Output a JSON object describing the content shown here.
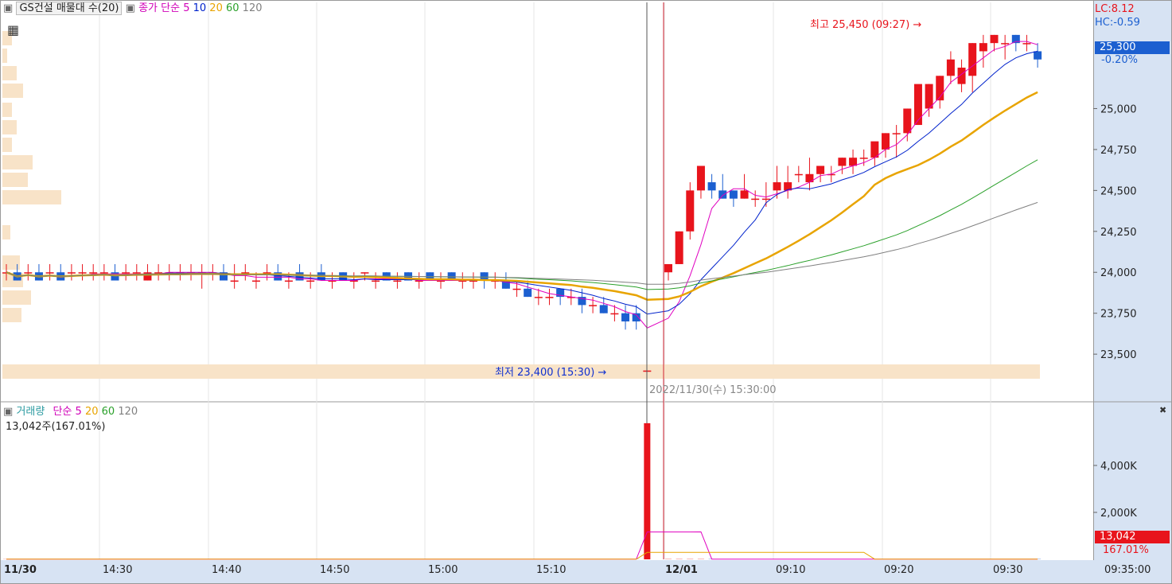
{
  "price_panel": {
    "title": "GS건설 매물대 수(20)",
    "ma_label": "종가 단순",
    "ma_periods": [
      "5",
      "10",
      "20",
      "60",
      "120"
    ],
    "ma_colors": [
      "#e000c0",
      "#0022cc",
      "#e8a400",
      "#2aa02a",
      "#808080"
    ],
    "lc": "LC:8.12",
    "hc": "HC:-0.59",
    "current_price": "25,300",
    "current_change": "-0.20%",
    "high_annotation": "최고 25,450 (09:27)",
    "low_annotation": "최저 23,400 (15:30)",
    "crosshair_label": "2022/11/30(수) 15:30:00"
  },
  "volume_panel": {
    "title": "거래량",
    "ma_label": "단순",
    "ma_periods": [
      "5",
      "20",
      "60",
      "120"
    ],
    "ma_colors": [
      "#e000c0",
      "#e8a400",
      "#2aa02a",
      "#808080"
    ],
    "summary": "13,042주(167.01%)",
    "current_volume": "13,042",
    "current_ratio": "167.01%"
  },
  "time_axis": {
    "labels": [
      "11/30",
      "14:30",
      "14:40",
      "14:50",
      "15:00",
      "15:10",
      "12/01",
      "09:10",
      "09:20",
      "09:30"
    ],
    "cursor_time": "09:35:00"
  },
  "colors": {
    "up": "#e8141c",
    "down": "#1c5fd0",
    "axis_bg": "#d7e3f3",
    "volume_profile": "#f8e3c8",
    "crosshair": "#d02030"
  },
  "chart_data": [
    {
      "type": "candlestick",
      "title": "GS건설 매물대 수(20)",
      "x": [
        "14:21",
        "14:22",
        "14:23",
        "14:24",
        "14:25",
        "14:26",
        "14:27",
        "14:28",
        "14:29",
        "14:30",
        "14:31",
        "14:32",
        "14:33",
        "14:34",
        "14:35",
        "14:36",
        "14:37",
        "14:38",
        "14:39",
        "14:40",
        "14:41",
        "14:42",
        "14:43",
        "14:44",
        "14:45",
        "14:46",
        "14:47",
        "14:48",
        "14:49",
        "14:50",
        "14:51",
        "14:52",
        "14:53",
        "14:54",
        "14:55",
        "14:56",
        "14:57",
        "14:58",
        "14:59",
        "15:00",
        "15:01",
        "15:02",
        "15:03",
        "15:04",
        "15:05",
        "15:06",
        "15:07",
        "15:08",
        "15:09",
        "15:10",
        "15:11",
        "15:12",
        "15:13",
        "15:14",
        "15:15",
        "15:16",
        "15:17",
        "15:18",
        "15:19",
        "15:30",
        "09:01",
        "09:02",
        "09:03",
        "09:04",
        "09:05",
        "09:06",
        "09:07",
        "09:08",
        "09:09",
        "09:10",
        "09:11",
        "09:12",
        "09:13",
        "09:14",
        "09:15",
        "09:16",
        "09:17",
        "09:18",
        "09:19",
        "09:20",
        "09:21",
        "09:22",
        "09:23",
        "09:24",
        "09:25",
        "09:26",
        "09:27",
        "09:28",
        "09:29",
        "09:30",
        "09:31",
        "09:32",
        "09:33",
        "09:34",
        "09:35"
      ],
      "ohlc": [
        [
          24000,
          24050,
          23950,
          24000
        ],
        [
          24000,
          24050,
          23950,
          23950
        ],
        [
          24000,
          24050,
          23950,
          24000
        ],
        [
          24000,
          24050,
          23950,
          23950
        ],
        [
          24000,
          24050,
          23950,
          24000
        ],
        [
          24000,
          24050,
          23950,
          23950
        ],
        [
          24000,
          24050,
          23950,
          24000
        ],
        [
          24000,
          24050,
          23950,
          24000
        ],
        [
          24000,
          24050,
          23950,
          24000
        ],
        [
          24000,
          24050,
          23950,
          24000
        ],
        [
          24000,
          24050,
          23950,
          23950
        ],
        [
          24000,
          24050,
          23950,
          24000
        ],
        [
          24000,
          24050,
          23950,
          24000
        ],
        [
          23950,
          24050,
          23950,
          24000
        ],
        [
          24000,
          24050,
          23950,
          24000
        ],
        [
          24000,
          24050,
          23950,
          24000
        ],
        [
          24000,
          24050,
          23950,
          24000
        ],
        [
          24000,
          24050,
          23950,
          24000
        ],
        [
          24000,
          24050,
          23900,
          24000
        ],
        [
          24000,
          24050,
          23950,
          24000
        ],
        [
          24000,
          24050,
          23950,
          23950
        ],
        [
          23950,
          24050,
          23900,
          23950
        ],
        [
          24000,
          24050,
          23950,
          24000
        ],
        [
          23950,
          24000,
          23900,
          23950
        ],
        [
          24000,
          24050,
          23950,
          24000
        ],
        [
          24000,
          24050,
          23950,
          23950
        ],
        [
          23950,
          24000,
          23900,
          23950
        ],
        [
          24000,
          24050,
          23950,
          23950
        ],
        [
          23950,
          24000,
          23900,
          23950
        ],
        [
          24000,
          24050,
          23950,
          23950
        ],
        [
          23950,
          24000,
          23900,
          23950
        ],
        [
          24000,
          24000,
          23950,
          23950
        ],
        [
          23950,
          24000,
          23900,
          23950
        ],
        [
          24000,
          24000,
          23950,
          24000
        ],
        [
          23950,
          24000,
          23900,
          23950
        ],
        [
          24000,
          24000,
          23950,
          23950
        ],
        [
          23950,
          24000,
          23900,
          23950
        ],
        [
          24000,
          24000,
          23950,
          23950
        ],
        [
          23950,
          24000,
          23900,
          23950
        ],
        [
          24000,
          24000,
          23950,
          23950
        ],
        [
          23950,
          24000,
          23900,
          23950
        ],
        [
          24000,
          24000,
          23950,
          23950
        ],
        [
          23950,
          24000,
          23900,
          23950
        ],
        [
          23950,
          24000,
          23900,
          23950
        ],
        [
          24000,
          24000,
          23900,
          23950
        ],
        [
          23950,
          24000,
          23900,
          23950
        ],
        [
          23950,
          24000,
          23900,
          23900
        ],
        [
          23900,
          23950,
          23850,
          23900
        ],
        [
          23900,
          23950,
          23850,
          23850
        ],
        [
          23850,
          23900,
          23800,
          23850
        ],
        [
          23850,
          23900,
          23800,
          23850
        ],
        [
          23900,
          23900,
          23800,
          23850
        ],
        [
          23850,
          23900,
          23800,
          23850
        ],
        [
          23850,
          23900,
          23750,
          23800
        ],
        [
          23800,
          23850,
          23750,
          23800
        ],
        [
          23800,
          23850,
          23750,
          23750
        ],
        [
          23750,
          23800,
          23700,
          23750
        ],
        [
          23750,
          23800,
          23650,
          23700
        ],
        [
          23750,
          23800,
          23650,
          23700
        ],
        [
          23400,
          23400,
          23400,
          23400
        ],
        [
          24000,
          24050,
          23950,
          24050
        ],
        [
          24050,
          24250,
          24050,
          24250
        ],
        [
          24250,
          24550,
          24200,
          24500
        ],
        [
          24500,
          24650,
          24450,
          24650
        ],
        [
          24550,
          24600,
          24450,
          24500
        ],
        [
          24500,
          24600,
          24450,
          24450
        ],
        [
          24500,
          24500,
          24400,
          24450
        ],
        [
          24450,
          24600,
          24450,
          24500
        ],
        [
          24450,
          24500,
          24400,
          24450
        ],
        [
          24450,
          24550,
          24400,
          24450
        ],
        [
          24500,
          24650,
          24450,
          24550
        ],
        [
          24500,
          24650,
          24450,
          24550
        ],
        [
          24600,
          24650,
          24550,
          24600
        ],
        [
          24550,
          24700,
          24500,
          24600
        ],
        [
          24600,
          24650,
          24550,
          24650
        ],
        [
          24600,
          24650,
          24550,
          24600
        ],
        [
          24650,
          24700,
          24600,
          24700
        ],
        [
          24650,
          24750,
          24600,
          24700
        ],
        [
          24700,
          24750,
          24650,
          24700
        ],
        [
          24700,
          24750,
          24650,
          24800
        ],
        [
          24750,
          24850,
          24700,
          24850
        ],
        [
          24850,
          24900,
          24700,
          24850
        ],
        [
          24850,
          25000,
          24800,
          25000
        ],
        [
          24900,
          25100,
          24900,
          25150
        ],
        [
          25000,
          25150,
          24950,
          25150
        ],
        [
          25050,
          25200,
          25000,
          25200
        ],
        [
          25200,
          25350,
          25150,
          25300
        ],
        [
          25150,
          25300,
          25100,
          25250
        ],
        [
          25200,
          25400,
          25100,
          25400
        ],
        [
          25350,
          25450,
          25250,
          25400
        ],
        [
          25400,
          25450,
          25350,
          25450
        ],
        [
          25400,
          25450,
          25300,
          25400
        ],
        [
          25450,
          25450,
          25350,
          25400
        ],
        [
          25400,
          25450,
          25350,
          25400
        ],
        [
          25350,
          25400,
          25250,
          25300
        ]
      ],
      "ylim": [
        23350,
        25600
      ],
      "y_ticks": [
        "23,500",
        "23,750",
        "24,000",
        "24,250",
        "24,500",
        "24,750",
        "25,000",
        "25,300"
      ],
      "high": {
        "value": 25450,
        "time": "09:27"
      },
      "low": {
        "value": 23400,
        "time": "15:30"
      }
    },
    {
      "type": "bar",
      "title": "거래량",
      "y_ticks": [
        "2,000K",
        "4,000K"
      ],
      "ylim": [
        0,
        6000
      ],
      "unit": "K",
      "annotated_spike": {
        "time": "15:30",
        "value_k": 5800
      }
    }
  ]
}
